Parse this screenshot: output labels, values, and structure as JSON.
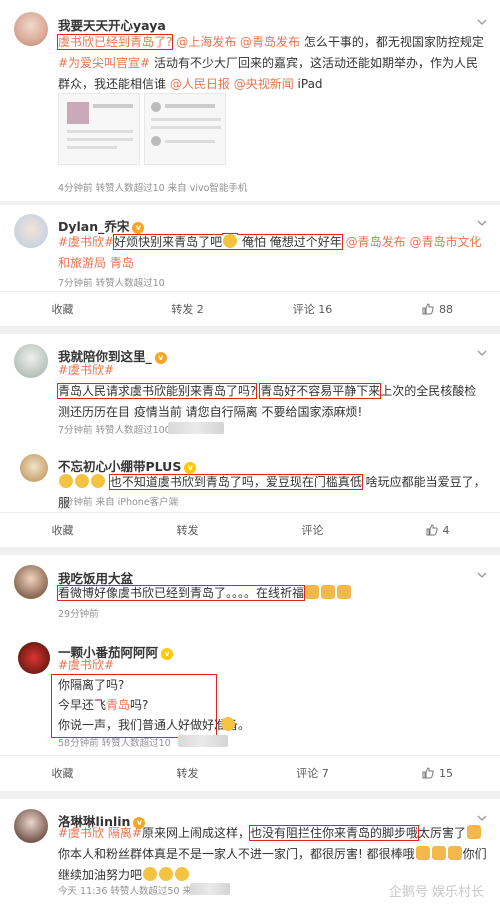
{
  "card1": {
    "user": "我要天天开心yaya",
    "text_parts": [
      "虞书欣已经到青岛了?",
      "@上海发布",
      "@青岛发布",
      "怎么干事的，都无视国家防控规定",
      "#为爱尖叫官宣#",
      "活动有不少大厂回来的嘉宾，这活动还能如期举办，作为人民群众，我还能相信谁",
      "@人民日报",
      "@央视新闻",
      "iPad"
    ],
    "meta": "4分钟前 转赞人数超过10 来自 vivo智能手机"
  },
  "card2": {
    "user": "Dylan_乔宋",
    "tags": [
      "#虞书欣#"
    ],
    "text_parts": [
      "好烦快别来青岛了吧",
      "俺怕 俺想过个好年",
      "@青岛发布",
      "@青岛市文化和旅游局",
      "青岛"
    ],
    "meta": "7分钟前 转赞人数超过10",
    "actions": {
      "fav": "收藏",
      "repost": "转发 2",
      "comment": "评论 16",
      "like": "88"
    }
  },
  "card3": {
    "user": "我就陪你到这里_",
    "tags": [
      "#虞书欣#"
    ],
    "text_parts": [
      "青岛人民请求虞书欣能别来青岛了吗?",
      "青岛好不容易平静下来",
      "上次的全民核酸检测还历历在目 疫情当前 请您自行隔离 不要给国家添麻烦!"
    ],
    "meta": "7分钟前 转赞人数超过100",
    "reply": {
      "user": "不忘初心小绷带PLUS",
      "text_parts": [
        "也不知道虞书欣到青岛了吗，爱豆现在门槛真低",
        "啥玩应都能当爱豆了，服"
      ],
      "meta": "7分钟前 来自 iPhone客户端"
    },
    "actions": {
      "fav": "收藏",
      "repost": "转发",
      "comment": "评论",
      "like": "4"
    }
  },
  "card4": {
    "user": "我吃饭用大盆",
    "text_parts": [
      "看微博好像虞书欣已经到青岛了。。。。在线祈福"
    ],
    "meta": "29分钟前",
    "reply": {
      "user": "一颗小番茄阿阿阿",
      "tags": [
        "#虞书欣#"
      ],
      "lines": [
        "你隔离了吗?",
        "今早还飞青岛吗?",
        "你说一声，我们普通人好做好准备。"
      ],
      "meta": "58分钟前 转赞人数超过10"
    },
    "actions": {
      "fav": "收藏",
      "repost": "转发",
      "comment": "评论 7",
      "like": "15"
    }
  },
  "card5": {
    "user": "洛琳琳linlin",
    "tags": [
      "#虞书欣 隔离#"
    ],
    "text_parts": [
      "原来网上闹成这样，",
      "也没有阻拦住你来青岛的脚步哦",
      "太厉害了",
      "你本人和粉丝群体真是不是一家人不进一家门，都很厉害! 都很棒哦",
      "你们继续加油努力吧"
    ],
    "meta": "今天 11:36 转赞人数超过50 来自"
  },
  "watermark": "企鹅号 娱乐村长"
}
